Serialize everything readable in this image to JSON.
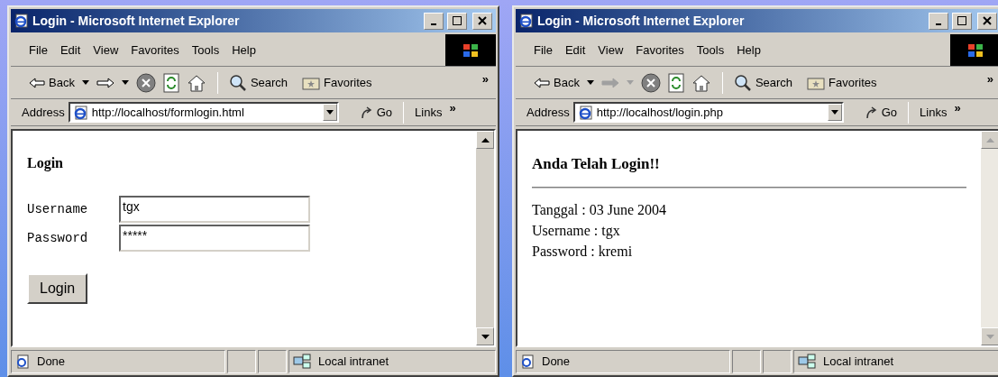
{
  "windows": [
    {
      "title": "Login - Microsoft Internet Explorer",
      "menu": [
        "File",
        "Edit",
        "View",
        "Favorites",
        "Tools",
        "Help"
      ],
      "toolbar": {
        "back": "Back",
        "forward_disabled": false,
        "search": "Search",
        "favorites": "Favorites",
        "more": "»"
      },
      "address": {
        "label": "Address",
        "url": "http://localhost/formlogin.html",
        "go": "Go",
        "links": "Links",
        "more": "»"
      },
      "scroll_enabled": true,
      "content": {
        "kind": "form",
        "heading": "Login",
        "fields": [
          {
            "label": "Username",
            "value": "tgx"
          },
          {
            "label": "Password",
            "value": "*****"
          }
        ],
        "button": "Login"
      },
      "status": {
        "text": "Done",
        "zone": "Local intranet"
      }
    },
    {
      "title": "Login - Microsoft Internet Explorer",
      "menu": [
        "File",
        "Edit",
        "View",
        "Favorites",
        "Tools",
        "Help"
      ],
      "toolbar": {
        "back": "Back",
        "forward_disabled": true,
        "search": "Search",
        "favorites": "Favorites",
        "more": "»"
      },
      "address": {
        "label": "Address",
        "url": "http://localhost/login.php",
        "go": "Go",
        "links": "Links",
        "more": "»"
      },
      "scroll_enabled": false,
      "content": {
        "kind": "result",
        "heading": "Anda Telah Login!!",
        "lines": [
          "Tanggal : 03 June 2004",
          "Username : tgx",
          "Password : kremi"
        ]
      },
      "status": {
        "text": "Done",
        "zone": "Local intranet"
      }
    }
  ]
}
